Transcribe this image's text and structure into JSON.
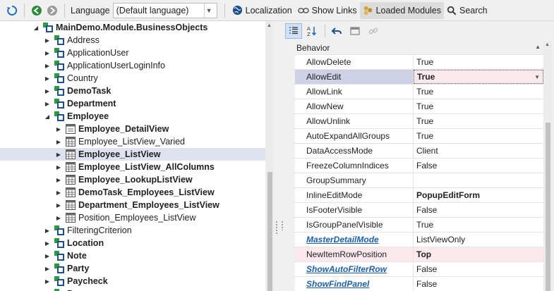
{
  "toolbar": {
    "language_label": "Language",
    "language_value": "(Default language)",
    "localization": "Localization",
    "show_links": "Show Links",
    "loaded_modules": "Loaded Modules",
    "search": "Search"
  },
  "tree": {
    "items": [
      {
        "label": "MainDemo.Module.BusinessObjects",
        "bold": true,
        "level": 0,
        "icon": "namespace-icon",
        "expanded": true
      },
      {
        "label": "Address",
        "bold": false,
        "level": 1,
        "icon": "class-icon"
      },
      {
        "label": "ApplicationUser",
        "bold": false,
        "level": 1,
        "icon": "class-icon"
      },
      {
        "label": "ApplicationUserLoginInfo",
        "bold": false,
        "level": 1,
        "icon": "class-icon"
      },
      {
        "label": "Country",
        "bold": false,
        "level": 1,
        "icon": "class-icon"
      },
      {
        "label": "DemoTask",
        "bold": true,
        "level": 1,
        "icon": "class-icon"
      },
      {
        "label": "Department",
        "bold": true,
        "level": 1,
        "icon": "class-icon"
      },
      {
        "label": "Employee",
        "bold": true,
        "level": 1,
        "icon": "class-icon",
        "expanded": true
      },
      {
        "label": "Employee_DetailView",
        "bold": true,
        "level": 2,
        "icon": "detail-view-icon"
      },
      {
        "label": "Employee_ListView_Varied",
        "bold": false,
        "level": 2,
        "icon": "list-view-icon"
      },
      {
        "label": "Employee_ListView",
        "bold": true,
        "level": 2,
        "icon": "list-view-icon",
        "selected": true
      },
      {
        "label": "Employee_ListView_AllColumns",
        "bold": true,
        "level": 2,
        "icon": "list-view-icon"
      },
      {
        "label": "Employee_LookupListView",
        "bold": true,
        "level": 2,
        "icon": "list-view-icon"
      },
      {
        "label": "DemoTask_Employees_ListView",
        "bold": true,
        "level": 2,
        "icon": "list-view-icon"
      },
      {
        "label": "Department_Employees_ListView",
        "bold": true,
        "level": 2,
        "icon": "list-view-icon"
      },
      {
        "label": "Position_Employees_ListView",
        "bold": false,
        "level": 2,
        "icon": "list-view-icon"
      },
      {
        "label": "FilteringCriterion",
        "bold": false,
        "level": 1,
        "icon": "class-icon"
      },
      {
        "label": "Location",
        "bold": true,
        "level": 1,
        "icon": "class-icon"
      },
      {
        "label": "Note",
        "bold": true,
        "level": 1,
        "icon": "class-icon"
      },
      {
        "label": "Party",
        "bold": true,
        "level": 1,
        "icon": "class-icon"
      },
      {
        "label": "Paycheck",
        "bold": true,
        "level": 1,
        "icon": "class-icon"
      },
      {
        "label": "P",
        "bold": true,
        "level": 1,
        "icon": "class-icon"
      }
    ]
  },
  "props": {
    "category": "Behavior",
    "rows": [
      {
        "name": "AllowDelete",
        "value": "True"
      },
      {
        "name": "AllowEdit",
        "value": "True",
        "selected": true,
        "value_bold": true
      },
      {
        "name": "AllowLink",
        "value": "True"
      },
      {
        "name": "AllowNew",
        "value": "True"
      },
      {
        "name": "AllowUnlink",
        "value": "True"
      },
      {
        "name": "AutoExpandAllGroups",
        "value": "True"
      },
      {
        "name": "DataAccessMode",
        "value": "Client"
      },
      {
        "name": "FreezeColumnIndices",
        "value": "False"
      },
      {
        "name": "GroupSummary",
        "value": ""
      },
      {
        "name": "InlineEditMode",
        "value": "PopupEditForm",
        "value_bold": true
      },
      {
        "name": "IsFooterVisible",
        "value": "False"
      },
      {
        "name": "IsGroupPanelVisible",
        "value": "True"
      },
      {
        "name": "MasterDetailMode",
        "value": "ListViewOnly",
        "link": true
      },
      {
        "name": "NewItemRowPosition",
        "value": "Top",
        "highlight": true,
        "value_bold": true
      },
      {
        "name": "ShowAutoFilterRow",
        "value": "False",
        "link": true
      },
      {
        "name": "ShowFindPanel",
        "value": "False",
        "link": true
      }
    ]
  },
  "colors": {
    "accent": "#1f5fa8",
    "selected_tree": "#dfe3f0",
    "highlight_row": "#fbe9ed"
  }
}
